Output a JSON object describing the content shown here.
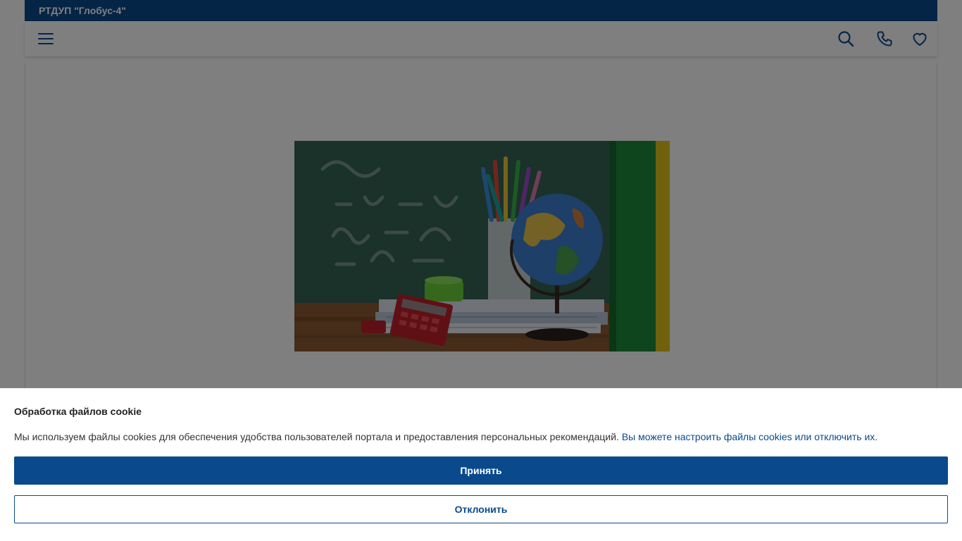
{
  "header": {
    "company_name": "РТДУП \"Глобус-4\""
  },
  "navbar": {
    "icons": [
      "menu-icon",
      "search-icon",
      "phone-icon",
      "heart-icon"
    ]
  },
  "cookie_banner": {
    "title": "Обработка файлов cookie",
    "text": "Мы используем файлы cookies для обеспечения удобства пользователей портала и предоставления персональных рекомендаций.",
    "link_text": "Вы можете настроить файлы cookies или отключить их.",
    "accept_label": "Принять",
    "decline_label": "Отклонить"
  },
  "colors": {
    "brand_blue": "#0a4a8c",
    "overlay": "rgba(0,0,0,0.5)"
  }
}
